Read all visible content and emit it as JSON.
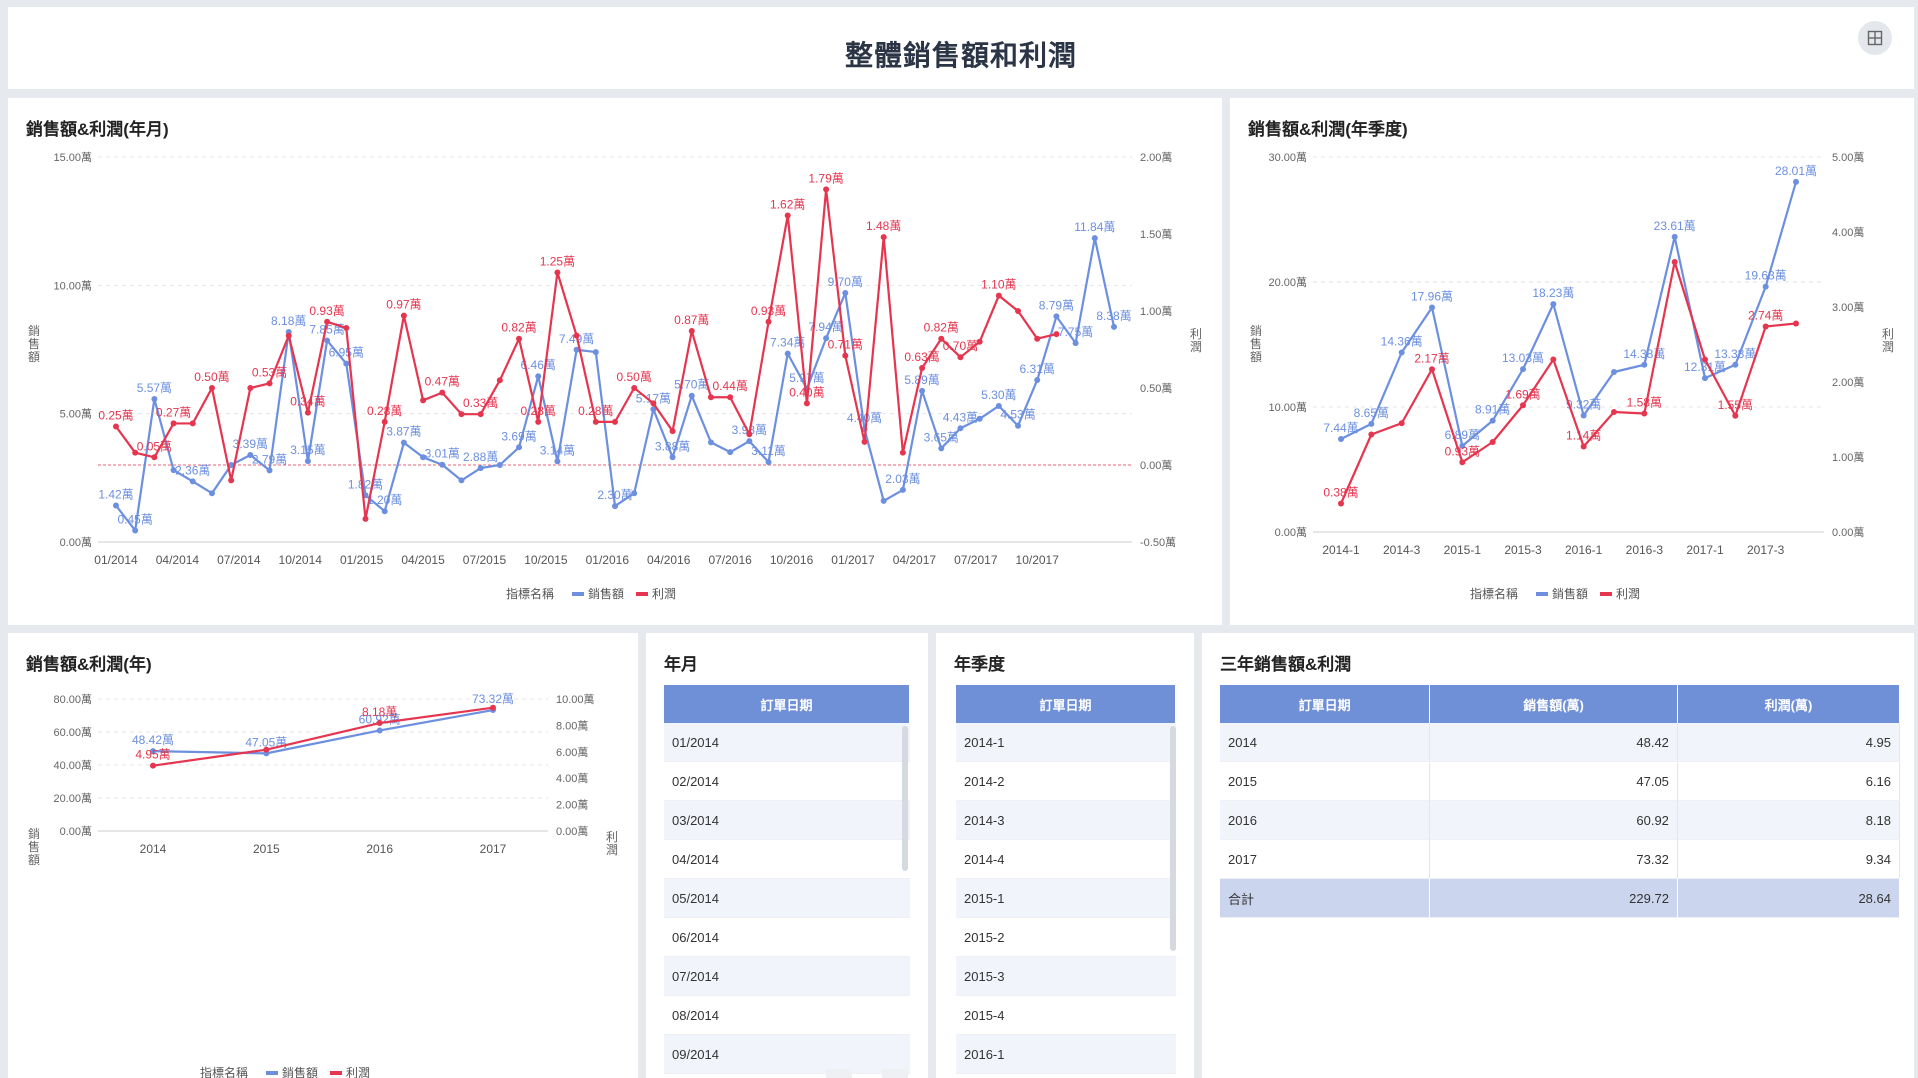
{
  "header": {
    "title": "整體銷售額和利潤"
  },
  "legend": {
    "prefix": "指標名稱",
    "sales": "銷售額",
    "profit": "利潤"
  },
  "axis_labels": {
    "left": "銷售額",
    "right": "利潤"
  },
  "colors": {
    "sales": "#6c8fe0",
    "profit": "#e5354f",
    "header": "#6f8fd6"
  },
  "chart_data": [
    {
      "id": "monthly",
      "type": "line",
      "title": "銷售額&利潤(年月)",
      "yleft": {
        "min": 0,
        "max": 15,
        "ticks": [
          "0.00萬",
          "5.00萬",
          "10.00萬",
          "15.00萬"
        ]
      },
      "yright": {
        "min": -0.5,
        "max": 2.0,
        "ticks": [
          "-0.50萬",
          "0.00萬",
          "0.50萬",
          "1.00萬",
          "1.50萬",
          "2.00萬"
        ]
      },
      "x_ticks": [
        "01/2014",
        "04/2014",
        "07/2014",
        "10/2014",
        "01/2015",
        "04/2015",
        "07/2015",
        "10/2015",
        "01/2016",
        "04/2016",
        "07/2016",
        "10/2016",
        "01/2017",
        "04/2017",
        "07/2017",
        "10/2017"
      ],
      "series": [
        {
          "name": "銷售額",
          "axis": "left",
          "values": [
            1.42,
            0.45,
            5.57,
            2.8,
            2.36,
            1.9,
            3.0,
            3.39,
            2.79,
            8.18,
            3.15,
            7.85,
            6.95,
            1.82,
            1.2,
            3.87,
            3.3,
            3.01,
            2.4,
            2.88,
            3.0,
            3.69,
            6.46,
            3.14,
            7.49,
            7.4,
            1.4,
            1.9,
            5.17,
            3.3,
            5.7,
            3.88,
            3.5,
            3.93,
            3.11,
            7.34,
            5.97,
            7.94,
            9.7,
            4.4,
            1.6,
            2.03,
            5.89,
            3.65,
            4.43,
            4.8,
            5.3,
            4.53,
            6.31,
            8.79,
            7.75,
            11.84,
            8.38
          ],
          "labels": [
            [
              0,
              "1.42萬"
            ],
            [
              1,
              "0.45萬"
            ],
            [
              2,
              "5.57萬"
            ],
            [
              4,
              "2.36萬"
            ],
            [
              7,
              "3.39萬"
            ],
            [
              8,
              "2.79萬"
            ],
            [
              9,
              "8.18萬"
            ],
            [
              10,
              "3.15萬"
            ],
            [
              11,
              "7.85萬"
            ],
            [
              12,
              "6.95萬"
            ],
            [
              13,
              "1.82萬"
            ],
            [
              14,
              "1.20萬"
            ],
            [
              15,
              "3.87萬"
            ],
            [
              17,
              "3.01萬"
            ],
            [
              19,
              "2.88萬"
            ],
            [
              21,
              "3.69萬"
            ],
            [
              22,
              "6.46萬"
            ],
            [
              23,
              "3.14萬"
            ],
            [
              24,
              "7.49萬"
            ],
            [
              26,
              "2.30萬"
            ],
            [
              28,
              "5.17萬"
            ],
            [
              29,
              "3.88萬"
            ],
            [
              30,
              "5.70萬"
            ],
            [
              33,
              "3.93萬"
            ],
            [
              34,
              "3.11萬"
            ],
            [
              35,
              "7.34萬"
            ],
            [
              36,
              "5.97萬"
            ],
            [
              37,
              "7.94萬"
            ],
            [
              38,
              "9.70萬"
            ],
            [
              39,
              "4.40萬"
            ],
            [
              41,
              "2.03萬"
            ],
            [
              42,
              "5.89萬"
            ],
            [
              43,
              "3.65萬"
            ],
            [
              44,
              "4.43萬"
            ],
            [
              46,
              "5.30萬"
            ],
            [
              47,
              "4.53萬"
            ],
            [
              48,
              "6.31萬"
            ],
            [
              49,
              "8.79萬"
            ],
            [
              50,
              "7.75萬"
            ],
            [
              51,
              "11.84萬"
            ],
            [
              52,
              "8.38萬"
            ]
          ]
        },
        {
          "name": "利潤",
          "axis": "right",
          "values": [
            0.25,
            0.08,
            0.05,
            0.27,
            0.27,
            0.5,
            -0.1,
            0.5,
            0.53,
            0.84,
            0.34,
            0.93,
            0.89,
            -0.35,
            0.28,
            0.97,
            0.42,
            0.47,
            0.33,
            0.33,
            0.55,
            0.82,
            0.28,
            1.25,
            0.84,
            0.28,
            0.28,
            0.5,
            0.4,
            0.22,
            0.87,
            0.44,
            0.44,
            0.2,
            0.93,
            1.62,
            0.4,
            1.79,
            0.71,
            0.15,
            1.48,
            0.08,
            0.63,
            0.82,
            0.7,
            0.8,
            1.1,
            1.0,
            0.82,
            0.85
          ],
          "labels": [
            [
              0,
              "0.25萬"
            ],
            [
              2,
              "0.05萬"
            ],
            [
              3,
              "0.27萬"
            ],
            [
              5,
              "0.50萬"
            ],
            [
              8,
              "0.53萬"
            ],
            [
              10,
              "0.34萬"
            ],
            [
              11,
              "0.93萬"
            ],
            [
              14,
              "0.28萬"
            ],
            [
              15,
              "0.97萬"
            ],
            [
              17,
              "0.47萬"
            ],
            [
              19,
              "0.33萬"
            ],
            [
              21,
              "0.82萬"
            ],
            [
              22,
              "0.28萬"
            ],
            [
              23,
              "1.25萬"
            ],
            [
              25,
              "0.28萬"
            ],
            [
              27,
              "0.50萬"
            ],
            [
              30,
              "0.87萬"
            ],
            [
              32,
              "0.44萬"
            ],
            [
              34,
              "0.93萬"
            ],
            [
              35,
              "1.62萬"
            ],
            [
              36,
              "0.40萬"
            ],
            [
              37,
              "1.79萬"
            ],
            [
              38,
              "0.71萬"
            ],
            [
              40,
              "1.48萬"
            ],
            [
              42,
              "0.63萬"
            ],
            [
              43,
              "0.82萬"
            ],
            [
              44,
              "0.70萬"
            ],
            [
              46,
              "1.10萬"
            ]
          ]
        }
      ]
    },
    {
      "id": "quarterly",
      "type": "line",
      "title": "銷售額&利潤(年季度)",
      "yleft": {
        "min": 0,
        "max": 30,
        "ticks": [
          "0.00萬",
          "10.00萬",
          "20.00萬",
          "30.00萬"
        ]
      },
      "yright": {
        "min": 0,
        "max": 5,
        "ticks": [
          "0.00萬",
          "1.00萬",
          "2.00萬",
          "3.00萬",
          "4.00萬",
          "5.00萬"
        ]
      },
      "x_ticks": [
        "2014-1",
        "2014-3",
        "2015-1",
        "2015-3",
        "2016-1",
        "2016-3",
        "2017-1",
        "2017-3"
      ],
      "series": [
        {
          "name": "銷售額",
          "axis": "left",
          "values": [
            7.44,
            8.65,
            14.36,
            17.96,
            6.89,
            8.91,
            13.03,
            18.23,
            9.32,
            12.8,
            13.38,
            23.61,
            12.31,
            13.38,
            19.63,
            28.01
          ],
          "labels": [
            [
              0,
              "7.44萬"
            ],
            [
              1,
              "8.65萬"
            ],
            [
              2,
              "14.36萬"
            ],
            [
              3,
              "17.96萬"
            ],
            [
              4,
              "6.89萬"
            ],
            [
              5,
              "8.91萬"
            ],
            [
              6,
              "13.03萬"
            ],
            [
              7,
              "18.23萬"
            ],
            [
              8,
              "9.32萬"
            ],
            [
              10,
              "14.38萬"
            ],
            [
              11,
              "23.61萬"
            ],
            [
              12,
              "12.31萬"
            ],
            [
              13,
              "13.38萬"
            ],
            [
              14,
              "19.63萬"
            ],
            [
              15,
              "28.01萬"
            ]
          ]
        },
        {
          "name": "利潤",
          "axis": "right",
          "values": [
            0.38,
            1.3,
            1.45,
            2.17,
            0.93,
            1.2,
            1.69,
            2.3,
            1.14,
            1.6,
            1.58,
            3.6,
            2.3,
            1.55,
            2.74,
            2.78
          ],
          "labels": [
            [
              0,
              "0.38萬"
            ],
            [
              3,
              "2.17萬"
            ],
            [
              4,
              "0.93萬"
            ],
            [
              6,
              "1.69萬"
            ],
            [
              8,
              "1.14萬"
            ],
            [
              10,
              "1.58萬"
            ],
            [
              13,
              "1.55萬"
            ],
            [
              14,
              "2.74萬"
            ]
          ]
        }
      ]
    },
    {
      "id": "yearly",
      "type": "line",
      "title": "銷售額&利潤(年)",
      "yleft": {
        "min": 0,
        "max": 80,
        "ticks": [
          "0.00萬",
          "20.00萬",
          "40.00萬",
          "60.00萬",
          "80.00萬"
        ]
      },
      "yright": {
        "min": 0,
        "max": 10,
        "ticks": [
          "0.00萬",
          "2.00萬",
          "4.00萬",
          "6.00萬",
          "8.00萬",
          "10.00萬"
        ]
      },
      "x_ticks": [
        "2014",
        "2015",
        "2016",
        "2017"
      ],
      "series": [
        {
          "name": "銷售額",
          "axis": "left",
          "values": [
            48.42,
            47.05,
            60.92,
            73.32
          ],
          "labels": [
            [
              0,
              "48.42萬"
            ],
            [
              1,
              "47.05萬"
            ],
            [
              2,
              "60.92萬"
            ],
            [
              3,
              "73.32萬"
            ]
          ]
        },
        {
          "name": "利潤",
          "axis": "right",
          "values": [
            4.95,
            6.16,
            8.18,
            9.34
          ],
          "labels": [
            [
              0,
              "4.95萬"
            ],
            [
              2,
              "8.18萬"
            ]
          ]
        }
      ]
    }
  ],
  "yearmonth_table": {
    "title": "年月",
    "header": "訂單日期",
    "rows": [
      "01/2014",
      "02/2014",
      "03/2014",
      "04/2014",
      "05/2014",
      "06/2014",
      "07/2014",
      "08/2014",
      "09/2014"
    ]
  },
  "quarter_table": {
    "title": "年季度",
    "header": "訂單日期",
    "rows": [
      "2014-1",
      "2014-2",
      "2014-3",
      "2014-4",
      "2015-1",
      "2015-2",
      "2015-3",
      "2015-4",
      "2016-1"
    ]
  },
  "summary_table": {
    "title": "三年銷售額&利潤",
    "headers": [
      "訂單日期",
      "銷售額(萬)",
      "利潤(萬)"
    ],
    "rows": [
      [
        "2014",
        "48.42",
        "4.95"
      ],
      [
        "2015",
        "47.05",
        "6.16"
      ],
      [
        "2016",
        "60.92",
        "8.18"
      ],
      [
        "2017",
        "73.32",
        "9.34"
      ]
    ],
    "total": [
      "合計",
      "229.72",
      "28.64"
    ]
  }
}
